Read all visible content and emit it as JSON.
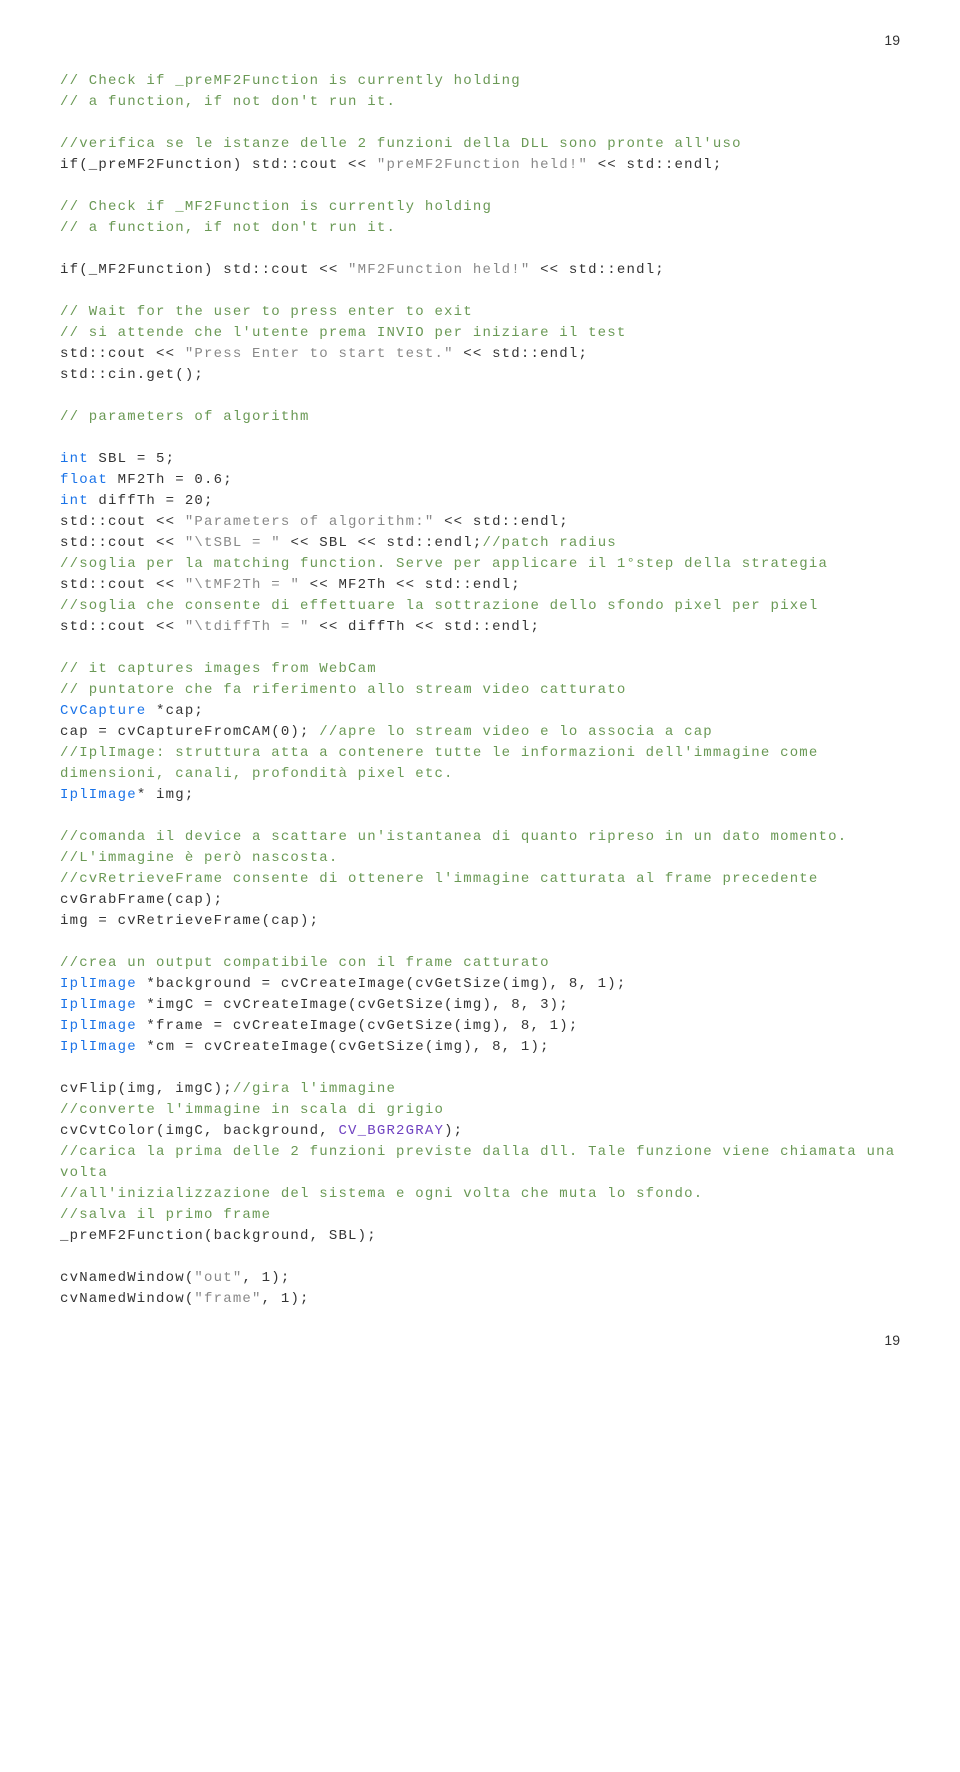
{
  "pageTop": "19",
  "pageBottom": "19",
  "c1": "// Check if _preMF2Function is currently holding",
  "c2": "// a function, if not don't run it.",
  "c3": "//verifica se le istanze delle 2 funzioni della DLL sono pronte all'uso",
  "l1a": "if(_preMF2Function) std::cout << ",
  "l1b": "\"preMF2Function held!\"",
  "l1c": " << std::endl;",
  "c4": "// Check if _MF2Function is currently holding",
  "c5": "// a function, if not don't run it.",
  "l2a": "if(_MF2Function) std::cout << ",
  "l2b": "\"MF2Function held!\"",
  "l2c": " << std::endl;",
  "c6": "// Wait for the user to press enter to exit",
  "c7": "// si attende che l'utente prema INVIO per iniziare il test",
  "l3a": "std::cout << ",
  "l3b": "\"Press Enter to start test.\"",
  "l3c": " << std::endl;",
  "l4": "std::cin.get();",
  "c8": "// parameters of algorithm",
  "l5a": "int",
  "l5b": " SBL = 5;",
  "l6a": "float",
  "l6b": " MF2Th = 0.6;",
  "l7a": "int",
  "l7b": " diffTh = 20;",
  "l8a": "std::cout << ",
  "l8b": "\"Parameters of algorithm:\"",
  "l8c": " << std::endl;",
  "l9a": "std::cout << ",
  "l9b": "\"\\tSBL = \"",
  "l9c": " << SBL << std::endl;",
  "c9": "//patch radius",
  "c10": "//soglia per la matching function. Serve per applicare il 1°step della strategia",
  "l10a": "std::cout << ",
  "l10b": "\"\\tMF2Th = \"",
  "l10c": " << MF2Th << std::endl;",
  "c11": "//soglia che consente di effettuare la sottrazione dello sfondo pixel per pixel",
  "l11a": "std::cout << ",
  "l11b": "\"\\tdiffTh = \"",
  "l11c": " << diffTh << std::endl;",
  "c12": "// it captures images from WebCam",
  "c13": "// puntatore che fa riferimento allo stream video catturato",
  "l12a": "CvCapture",
  "l12b": " *cap;",
  "l13a": "cap = cvCaptureFromCAM(0); ",
  "c14": "//apre lo stream video e lo associa a cap",
  "c15": "//IplImage: struttura atta a contenere tutte le informazioni dell'immagine come dimensioni, canali, profondità pixel etc.",
  "l14a": "IplImage",
  "l14b": "* img;",
  "c16": "//comanda il device a scattare un'istantanea di quanto ripreso in un dato momento.",
  "c17": "//L'immagine è però nascosta.",
  "c18": "//cvRetrieveFrame consente di ottenere l'immagine catturata al frame precedente",
  "l15": "cvGrabFrame(cap);",
  "l16": "img = cvRetrieveFrame(cap);",
  "c19": "//crea un output compatibile con il frame catturato",
  "l17a": "IplImage",
  "l17b": " *background = cvCreateImage(cvGetSize(img), 8, 1);",
  "l18a": "IplImage",
  "l18b": " *imgC = cvCreateImage(cvGetSize(img), 8, 3);",
  "l19a": "IplImage",
  "l19b": " *frame = cvCreateImage(cvGetSize(img), 8, 1);",
  "l20a": "IplImage",
  "l20b": " *cm = cvCreateImage(cvGetSize(img), 8, 1);",
  "l21": "cvFlip(img, imgC);",
  "c20": "//gira l'immagine",
  "c21": "//converte l'immagine in scala di grigio",
  "l22a": "cvCvtColor(imgC, background, ",
  "l22b": "CV_BGR2GRAY",
  "l22c": ");",
  "c22": "//carica la prima delle 2 funzioni previste dalla dll. Tale funzione viene chiamata una volta",
  "c23": "//all'inizializzazione del sistema e ogni volta che muta lo sfondo.",
  "c24": "//salva il primo frame",
  "l23": "_preMF2Function(background, SBL);",
  "l24a": "cvNamedWindow(",
  "l24b": "\"out\"",
  "l24c": ", 1);",
  "l25a": "cvNamedWindow(",
  "l25b": "\"frame\"",
  "l25c": ", 1);"
}
